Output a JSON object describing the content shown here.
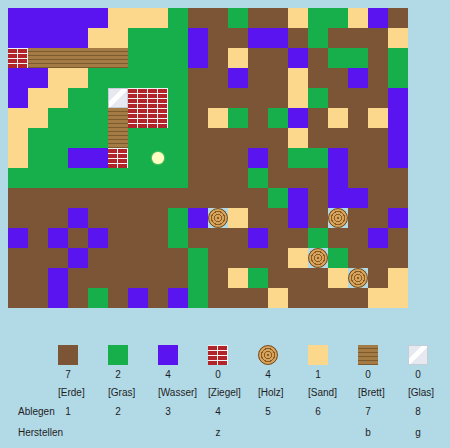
{
  "map": {
    "rows": [
      "WWWWWSSSGEEGEESGGSWE",
      "WWWWSSGGGWEEWWEGEEES",
      "ZBBBBBGGGWESEEWEGGEG",
      "WWSSGGGGGEEWEESEEWEG",
      "WSSGGXZZGEEEEESGEEEW",
      "SSGGGBZZGESGEGWESESW",
      "SGGGGBGGGEEEEESEEEEW",
      "SGGWWZGGGEEEWEGGWEEW",
      "GGGGGGGGGEEEGEEEWEEE",
      "EEEEEEEEEEEEEGWEWWEE",
      "EEEWEEEEGWHSEEWEHEEW",
      "WEWEWEEEGEEEWEEGEEWE",
      "EEEWEEEEEGEEEESHGEEE",
      "EEWEEEEEEGESGEEESHES",
      "EEWEGEWEWGEEESEEEESS"
    ],
    "player": {
      "row": 7,
      "col": 7
    }
  },
  "inventory": {
    "row_labels": {
      "drop": "Ablegen",
      "craft": "Herstellen"
    },
    "items": [
      {
        "code": "E",
        "name": "[Erde]",
        "count": "7",
        "drop_key": "1",
        "craft_key": "",
        "kind": "plain",
        "color": "#7b5536"
      },
      {
        "code": "G",
        "name": "[Gras]",
        "count": "2",
        "drop_key": "2",
        "craft_key": "",
        "kind": "plain",
        "color": "#17ae4c"
      },
      {
        "code": "W",
        "name": "[Wasser]",
        "count": "4",
        "drop_key": "3",
        "craft_key": "",
        "kind": "plain",
        "color": "#5a14ef"
      },
      {
        "code": "Z",
        "name": "[Ziegel]",
        "count": "0",
        "drop_key": "4",
        "craft_key": "z",
        "kind": "brick",
        "color": "#b3242a"
      },
      {
        "code": "H",
        "name": "[Holz]",
        "count": "4",
        "drop_key": "5",
        "craft_key": "",
        "kind": "wood",
        "color": "#d5a35b"
      },
      {
        "code": "S",
        "name": "[Sand]",
        "count": "1",
        "drop_key": "6",
        "craft_key": "",
        "kind": "plain",
        "color": "#fcd88c"
      },
      {
        "code": "B",
        "name": "[Brett]",
        "count": "0",
        "drop_key": "7",
        "craft_key": "b",
        "kind": "board",
        "color": "#a57b45"
      },
      {
        "code": "X",
        "name": "[Glas]",
        "count": "0",
        "drop_key": "8",
        "craft_key": "g",
        "kind": "glass",
        "color": "#e6e9f0"
      }
    ]
  }
}
